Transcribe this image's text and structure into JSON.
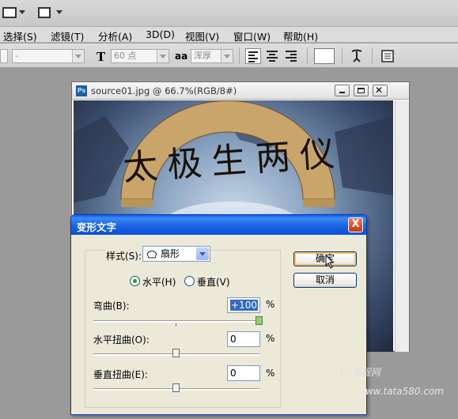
{
  "menu": [
    "选择(S)",
    "滤镜(T)",
    "分析(A)",
    "3D(D)",
    "视图(V)",
    "窗口(W)",
    "帮助(H)"
  ],
  "options": {
    "font_family": "-",
    "font_size": "60 点",
    "antialias": "浑厚"
  },
  "document": {
    "title": "source01.jpg @ 66.7%(RGB/8#)",
    "app_badge": "Ps",
    "warp_text": "太极生两仪"
  },
  "dialog": {
    "title": "变形文字",
    "close": "X",
    "style_label": "样式(S):",
    "style_value": "扇形",
    "horizontal_label": "水平(H)",
    "vertical_label": "垂直(V)",
    "bend_label": "弯曲(B):",
    "bend_value": "+100",
    "hdistort_label": "水平扭曲(O):",
    "hdistort_value": "0",
    "vdistort_label": "垂直扭曲(E):",
    "vdistort_value": "0",
    "percent": "%",
    "ok": "确定",
    "cancel": "取消",
    "orientation": "horizontal",
    "bend_level_pct": 100,
    "hdistort_level_pct": 0,
    "vdistort_level_pct": 0
  },
  "watermark": {
    "line1": "PS教程网",
    "line2": "www.tata580.com"
  },
  "colors": {
    "titlebar": "#1d63e2",
    "selection": "#316ac5"
  }
}
